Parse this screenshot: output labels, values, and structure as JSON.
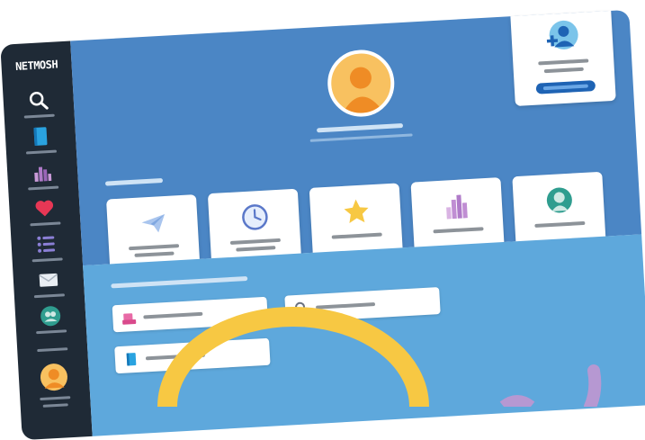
{
  "app": {
    "logo_text": "NETMOSH"
  },
  "sidebar": {
    "items": [
      {
        "name": "search",
        "icon": "magnifier-icon"
      },
      {
        "name": "book",
        "icon": "book-icon"
      },
      {
        "name": "stats",
        "icon": "bar-chart-icon"
      },
      {
        "name": "favorites",
        "icon": "heart-icon"
      },
      {
        "name": "list",
        "icon": "list-icon"
      },
      {
        "name": "mail",
        "icon": "envelope-icon"
      },
      {
        "name": "community",
        "icon": "people-icon"
      }
    ],
    "profile_icon": "user-avatar-icon"
  },
  "header": {
    "avatar_icon": "user-avatar-icon",
    "add_user_icon": "add-user-icon"
  },
  "tiles": [
    {
      "name": "send",
      "icon": "paper-plane-icon"
    },
    {
      "name": "history",
      "icon": "clock-icon"
    },
    {
      "name": "favorites",
      "icon": "star-icon"
    },
    {
      "name": "analytics",
      "icon": "bar-chart-icon"
    },
    {
      "name": "contact",
      "icon": "person-icon"
    }
  ],
  "fields": [
    {
      "name": "field-one",
      "icon": "stamp-icon"
    },
    {
      "name": "search",
      "icon": "search-icon"
    },
    {
      "name": "field-two",
      "icon": "book-icon"
    }
  ],
  "colors": {
    "sidebar": "#1f2a36",
    "header": "#4b86c5",
    "content": "#5ea8dc",
    "accent": "#1e63b4",
    "yellow": "#f7c843",
    "purple": "#b698d2"
  }
}
